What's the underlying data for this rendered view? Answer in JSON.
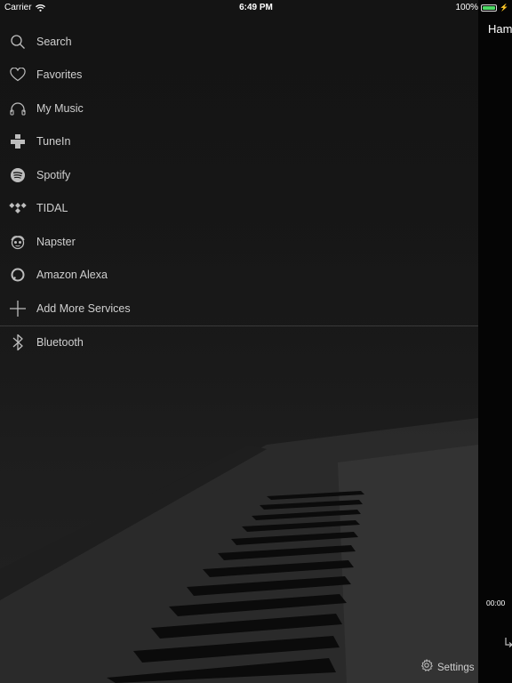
{
  "status_bar": {
    "carrier": "Carrier",
    "time": "6:49 PM",
    "battery": "100%"
  },
  "menu": {
    "items": [
      {
        "label": "Search",
        "icon": "search-icon"
      },
      {
        "label": "Favorites",
        "icon": "heart-icon"
      },
      {
        "label": "My Music",
        "icon": "headphones-icon"
      },
      {
        "label": "TuneIn",
        "icon": "tunein-icon"
      },
      {
        "label": "Spotify",
        "icon": "spotify-icon"
      },
      {
        "label": "TIDAL",
        "icon": "tidal-icon"
      },
      {
        "label": "Napster",
        "icon": "napster-icon"
      },
      {
        "label": "Amazon Alexa",
        "icon": "alexa-icon"
      },
      {
        "label": "Add More Services",
        "icon": "plus-icon"
      }
    ],
    "bluetooth_label": "Bluetooth"
  },
  "side_panel": {
    "title": "Ham",
    "time": "00:00"
  },
  "settings_label": "Settings",
  "colors": {
    "background": "#141414",
    "text": "#cfcfcf",
    "battery": "#4cd964"
  }
}
